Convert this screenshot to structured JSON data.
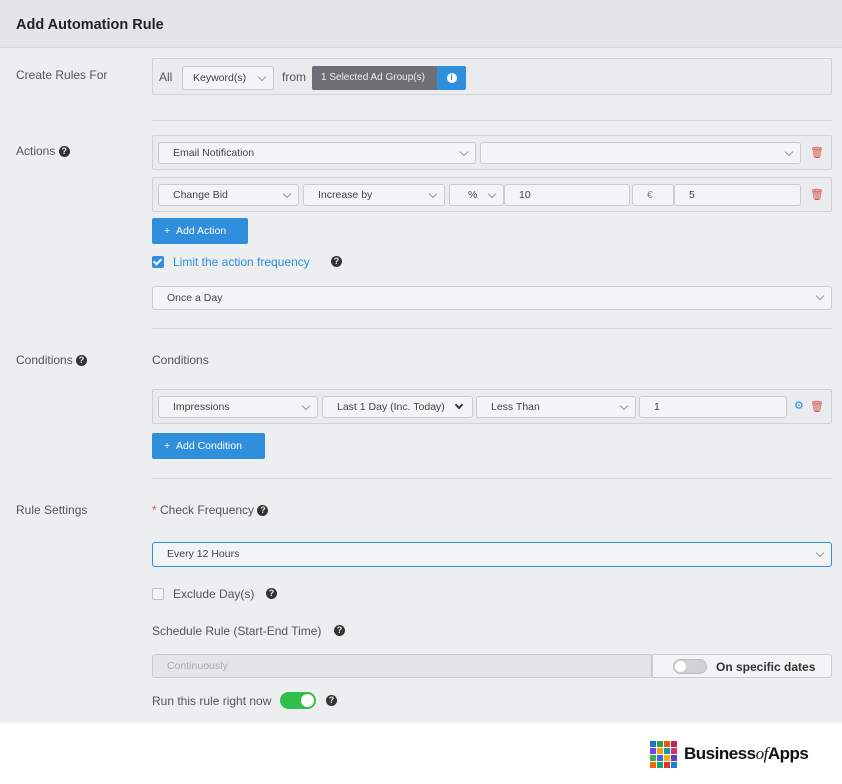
{
  "header": {
    "title": "Add Automation Rule"
  },
  "create_rules": {
    "label": "Create Rules For",
    "all_text": "All",
    "target_select": "Keyword(s)",
    "from_text": "from",
    "ad_group_btn": "1 Selected Ad Group(s)",
    "info_icon": "i"
  },
  "actions": {
    "label": "Actions",
    "row1": {
      "action": "Email Notification",
      "value": ""
    },
    "row2": {
      "action": "Change Bid",
      "mode": "Increase by",
      "unit": "%",
      "amount": "10",
      "currency": "€",
      "limit": "5"
    },
    "add_action": "Add Action",
    "limit_label": "Limit the action frequency",
    "frequency": "Once a Day"
  },
  "conditions": {
    "label": "Conditions",
    "heading": "Conditions",
    "metric": "Impressions",
    "period": "Last 1 Day (Inc. Today)",
    "operator": "Less Than",
    "value": "1",
    "add_condition": "Add Condition"
  },
  "rule_settings": {
    "label": "Rule Settings",
    "required_mark": "*",
    "check_frequency_label": "Check Frequency",
    "check_frequency": "Every 12 Hours",
    "exclude_days": "Exclude Day(s)",
    "schedule_label": "Schedule Rule (Start-End Time)",
    "schedule_placeholder": "Continuously",
    "specific_dates": "On specific dates",
    "run_now": "Run this rule right now"
  },
  "brand": {
    "business": "Business",
    "of": "of",
    "apps": "Apps"
  },
  "colors": {
    "accent": "#2f8fdc",
    "danger": "#d9534f",
    "toggle_on": "#2fbf4a"
  }
}
